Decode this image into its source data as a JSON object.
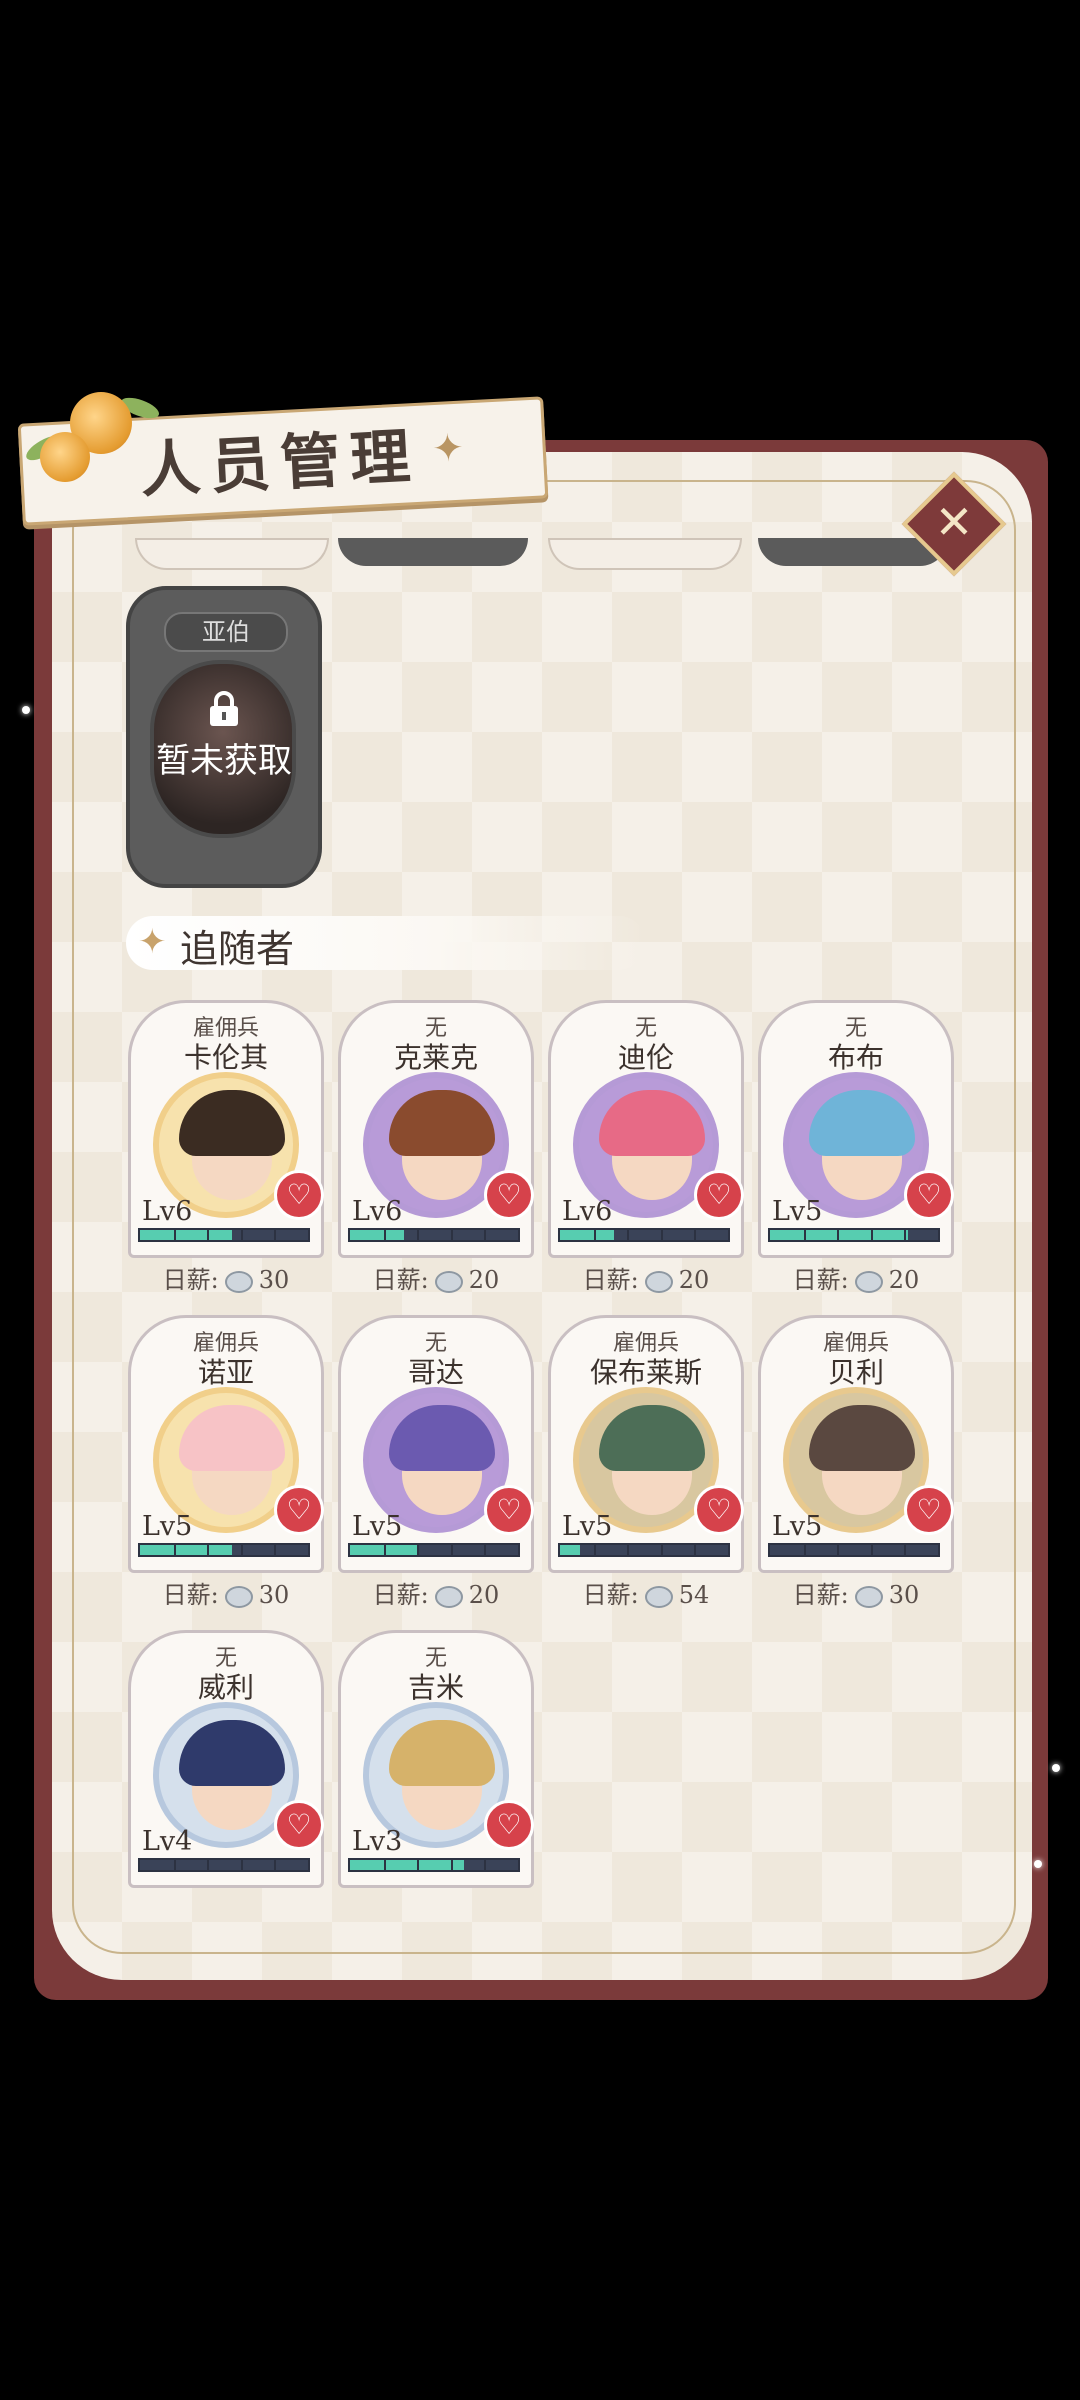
{
  "title": "人员管理",
  "locked_card": {
    "name": "亚伯",
    "status": "暂未获取"
  },
  "section": {
    "title": "追随者"
  },
  "wage_label": "日薪:",
  "followers": [
    {
      "role": "雇佣兵",
      "name": "卡伦其",
      "level": "Lv6",
      "exp": 0.55,
      "wage": "30",
      "hair": "#3b2c22",
      "ring": "#f1cf8a",
      "bg": "#f7e2ad"
    },
    {
      "role": "无",
      "name": "克莱克",
      "level": "Lv6",
      "exp": 0.32,
      "wage": "20",
      "hair": "#8a4b2e",
      "ring": "#b59ad6",
      "bg": "#b89bd8"
    },
    {
      "role": "无",
      "name": "迪伦",
      "level": "Lv6",
      "exp": 0.32,
      "wage": "20",
      "hair": "#e76a86",
      "ring": "#b59ad6",
      "bg": "#b89bd8"
    },
    {
      "role": "无",
      "name": "布布",
      "level": "Lv5",
      "exp": 0.82,
      "wage": "20",
      "hair": "#6fb4d8",
      "ring": "#b59ad6",
      "bg": "#b89bd8"
    },
    {
      "role": "雇佣兵",
      "name": "诺亚",
      "level": "Lv5",
      "exp": 0.55,
      "wage": "30",
      "hair": "#f7c3c6",
      "ring": "#f1cf8a",
      "bg": "#f7e2ad"
    },
    {
      "role": "无",
      "name": "哥达",
      "level": "Lv5",
      "exp": 0.4,
      "wage": "20",
      "hair": "#6b5ab0",
      "ring": "#b59ad6",
      "bg": "#b89bd8"
    },
    {
      "role": "雇佣兵",
      "name": "保布莱斯",
      "level": "Lv5",
      "exp": 0.12,
      "wage": "54",
      "hair": "#4d6e57",
      "ring": "#e8c98e",
      "bg": "#d8c7a0"
    },
    {
      "role": "雇佣兵",
      "name": "贝利",
      "level": "Lv5",
      "exp": 0.0,
      "wage": "30",
      "hair": "#5a4840",
      "ring": "#e8c98e",
      "bg": "#d8c7a0"
    },
    {
      "role": "无",
      "name": "威利",
      "level": "Lv4",
      "exp": 0.0,
      "wage": "",
      "hair": "#2f3a6b",
      "ring": "#b7c8de",
      "bg": "#d5e0ec"
    },
    {
      "role": "无",
      "name": "吉米",
      "level": "Lv3",
      "exp": 0.68,
      "wage": "",
      "hair": "#d6b26a",
      "ring": "#b7c8de",
      "bg": "#d5e0ec"
    }
  ]
}
